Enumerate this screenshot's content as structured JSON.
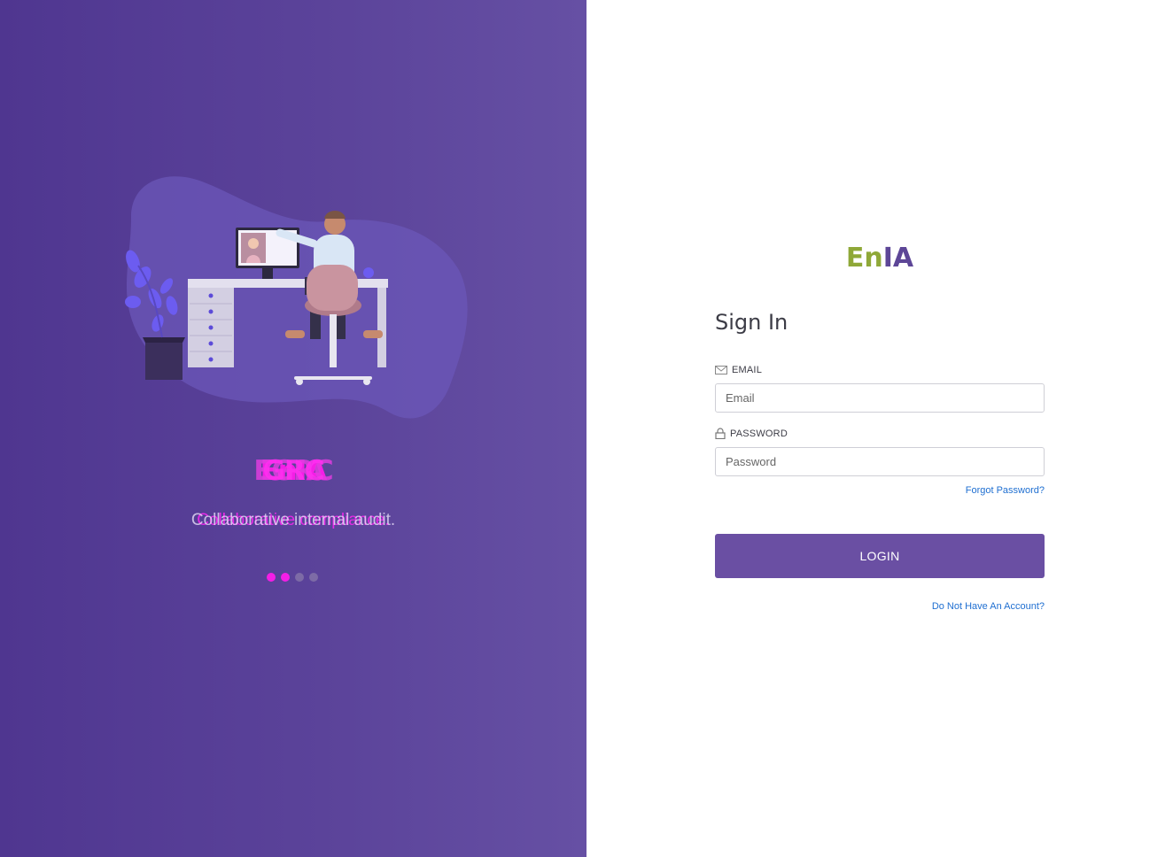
{
  "carousel": {
    "slides": [
      {
        "title": "EnIA",
        "subtitle": "Collaborative compliance."
      },
      {
        "title": "EGRC",
        "subtitle": "Collaborative internal audit."
      },
      {
        "title": "GRC",
        "subtitle": ""
      }
    ],
    "dot_count": 4,
    "active_dots": [
      0,
      1
    ]
  },
  "brand": {
    "part1": "En",
    "part2": "IA"
  },
  "form": {
    "title": "Sign In",
    "email_label": "EMAIL",
    "email_placeholder": "Email",
    "password_label": "PASSWORD",
    "password_placeholder": "Password",
    "forgot_link": "Forgot Password?",
    "login_button": "LOGIN",
    "signup_link": "Do Not Have An Account?"
  },
  "colors": {
    "brand_green": "#8fa838",
    "brand_purple": "#5d4697",
    "button": "#6a4fa3",
    "carousel_text": "#f41ee6",
    "link": "#1f6fd1"
  },
  "icons": {
    "email": "envelope-icon",
    "password": "lock-icon"
  }
}
